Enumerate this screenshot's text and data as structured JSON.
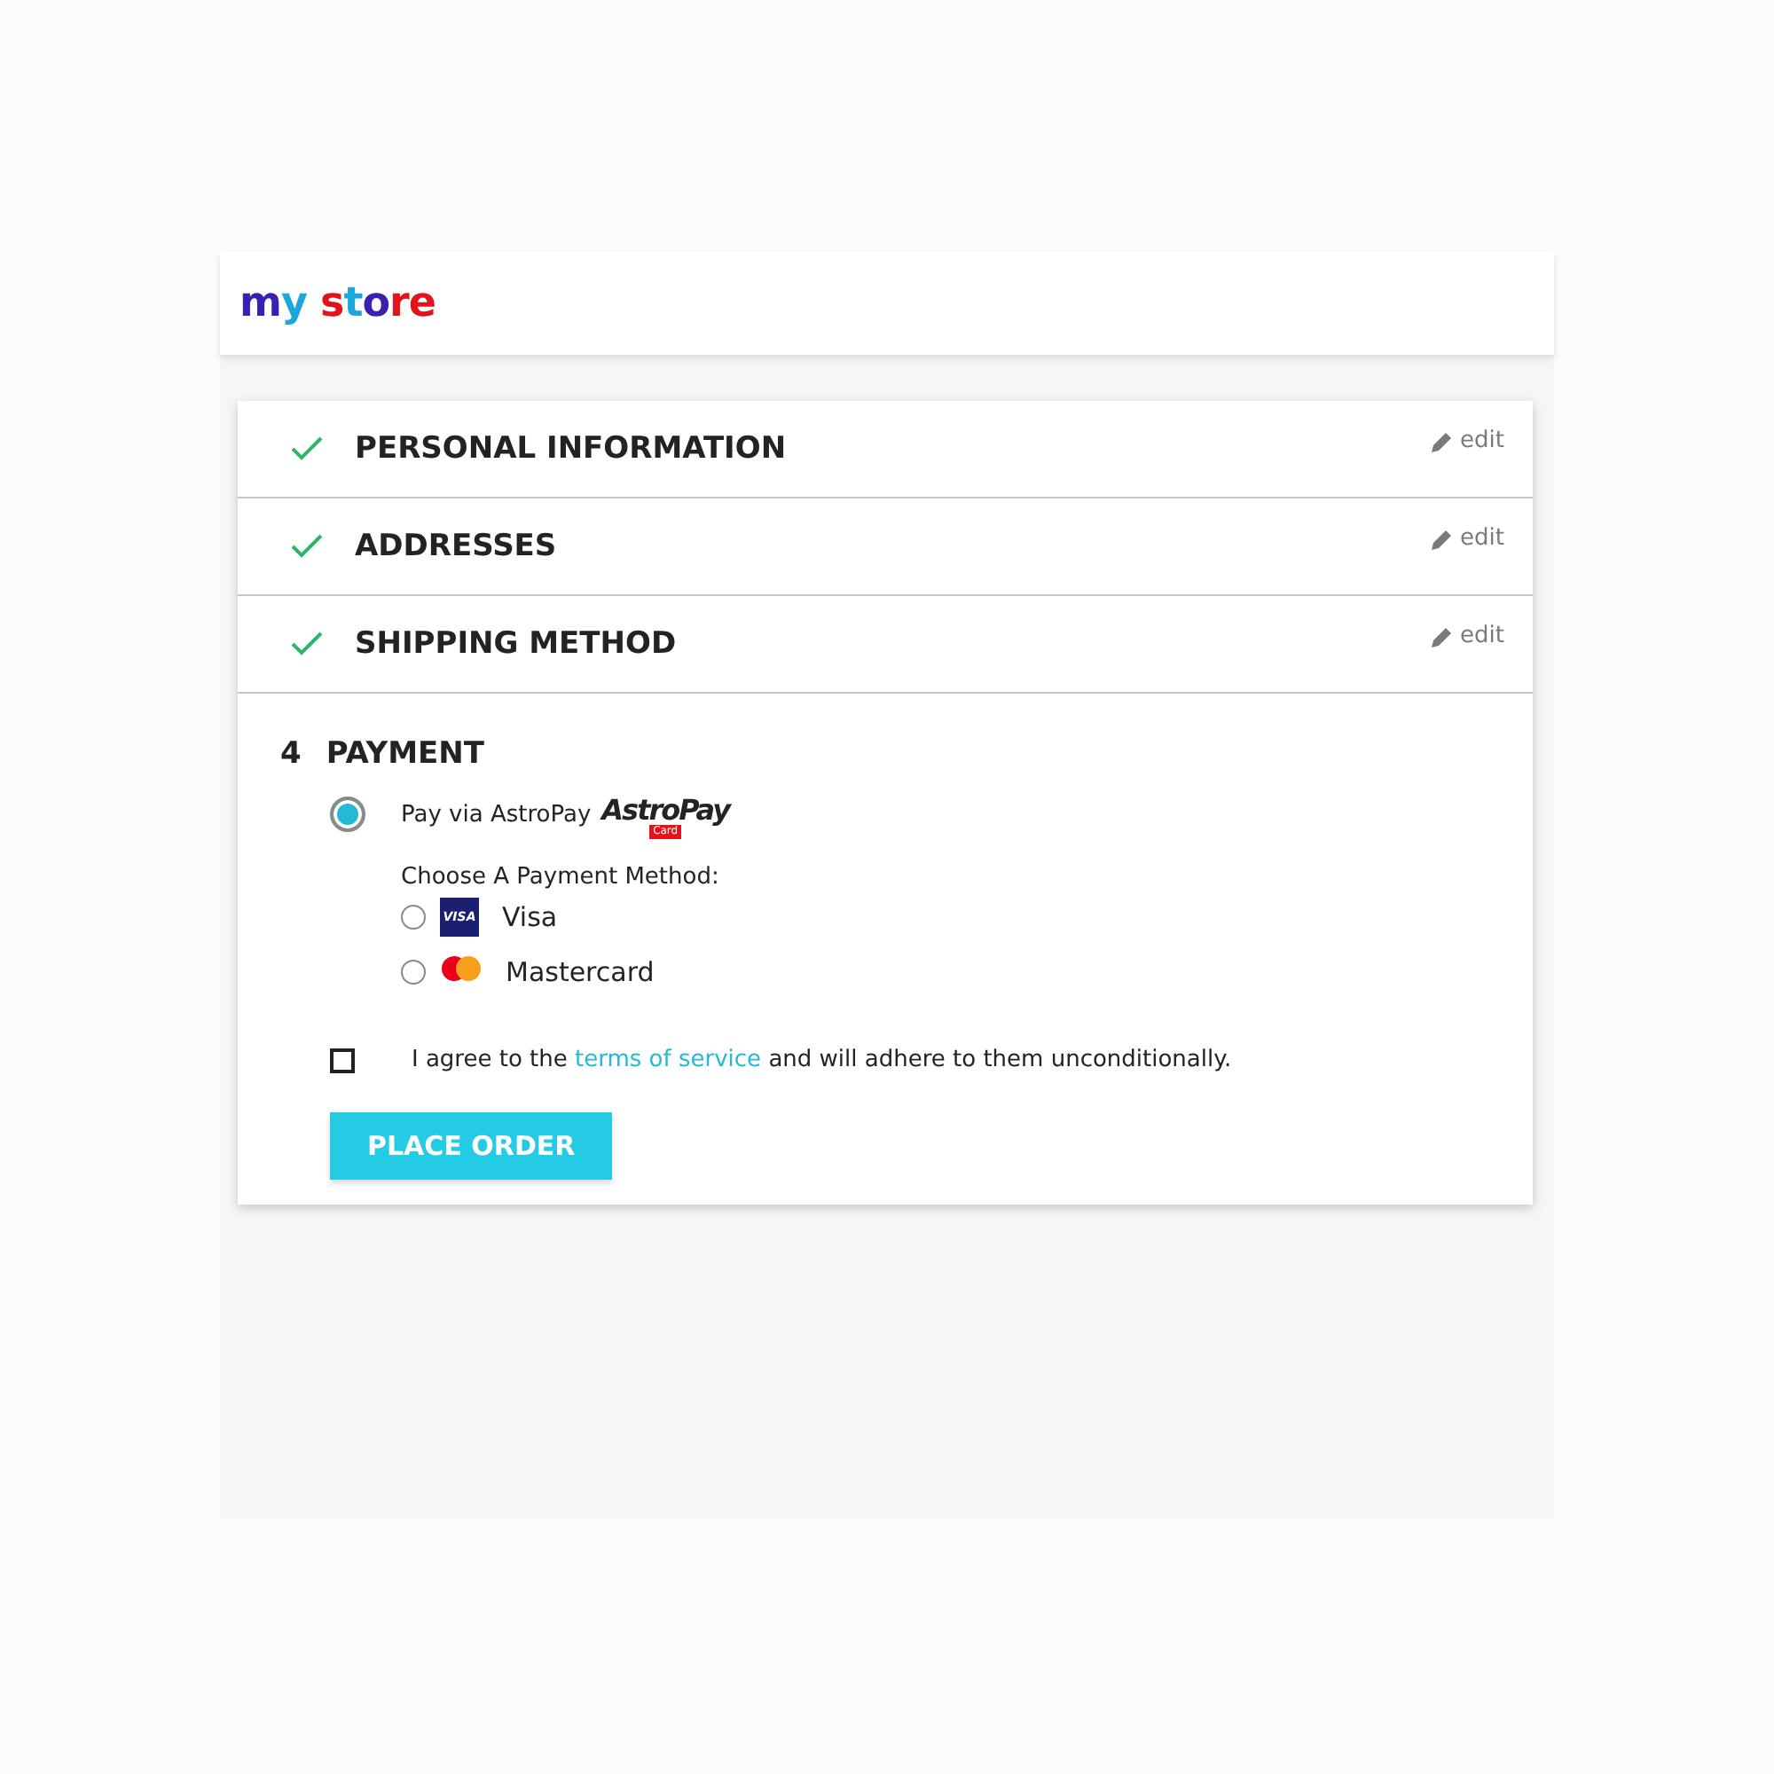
{
  "logo": {
    "text": "my store"
  },
  "steps": [
    {
      "title": "PERSONAL INFORMATION",
      "complete": true,
      "edit": "edit"
    },
    {
      "title": "ADDRESSES",
      "complete": true,
      "edit": "edit"
    },
    {
      "title": "SHIPPING METHOD",
      "complete": true,
      "edit": "edit"
    }
  ],
  "payment": {
    "number": "4",
    "title": "PAYMENT",
    "option": {
      "label": "Pay via AstroPay",
      "selected": true,
      "logo": "AstroPay",
      "logo_badge": "Card"
    },
    "method_label": "Choose A Payment Method:",
    "methods": [
      {
        "kind": "visa",
        "label": "Visa",
        "selected": false,
        "logo": "VISA"
      },
      {
        "kind": "mastercard",
        "label": "Mastercard",
        "selected": false
      }
    ],
    "terms": {
      "checked": false,
      "before": "I agree to the",
      "link": "terms of service",
      "after": "and will adhere to them unconditionally."
    },
    "button": "PLACE ORDER"
  }
}
